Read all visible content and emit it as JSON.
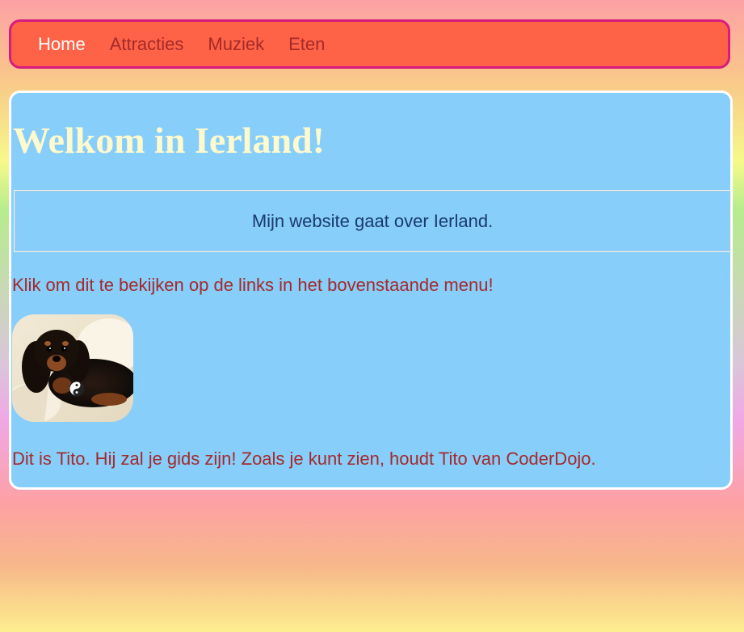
{
  "nav": {
    "items": [
      {
        "label": "Home",
        "active": true
      },
      {
        "label": "Attracties",
        "active": false
      },
      {
        "label": "Muziek",
        "active": false
      },
      {
        "label": "Eten",
        "active": false
      }
    ]
  },
  "main": {
    "title": "Welkom in Ierland!",
    "intro": "Mijn website gaat over Ierland.",
    "links_text": "Klik om dit te bekijken op de links in het bovenstaande menu!",
    "tito_text": "Dit is Tito. Hij zal je gids zijn! Zoals je kunt zien, houdt Tito van CoderDojo.",
    "image_icon": "yin-yang-icon"
  },
  "colors": {
    "nav_bg": "#ff6347",
    "nav_border": "#d81b7e",
    "nav_link": "#a52a2a",
    "nav_active": "#ffffff",
    "content_bg": "#87cefa",
    "title": "#fffacd",
    "body_text": "#a52a2a",
    "intro_text": "#1a3a6e"
  }
}
